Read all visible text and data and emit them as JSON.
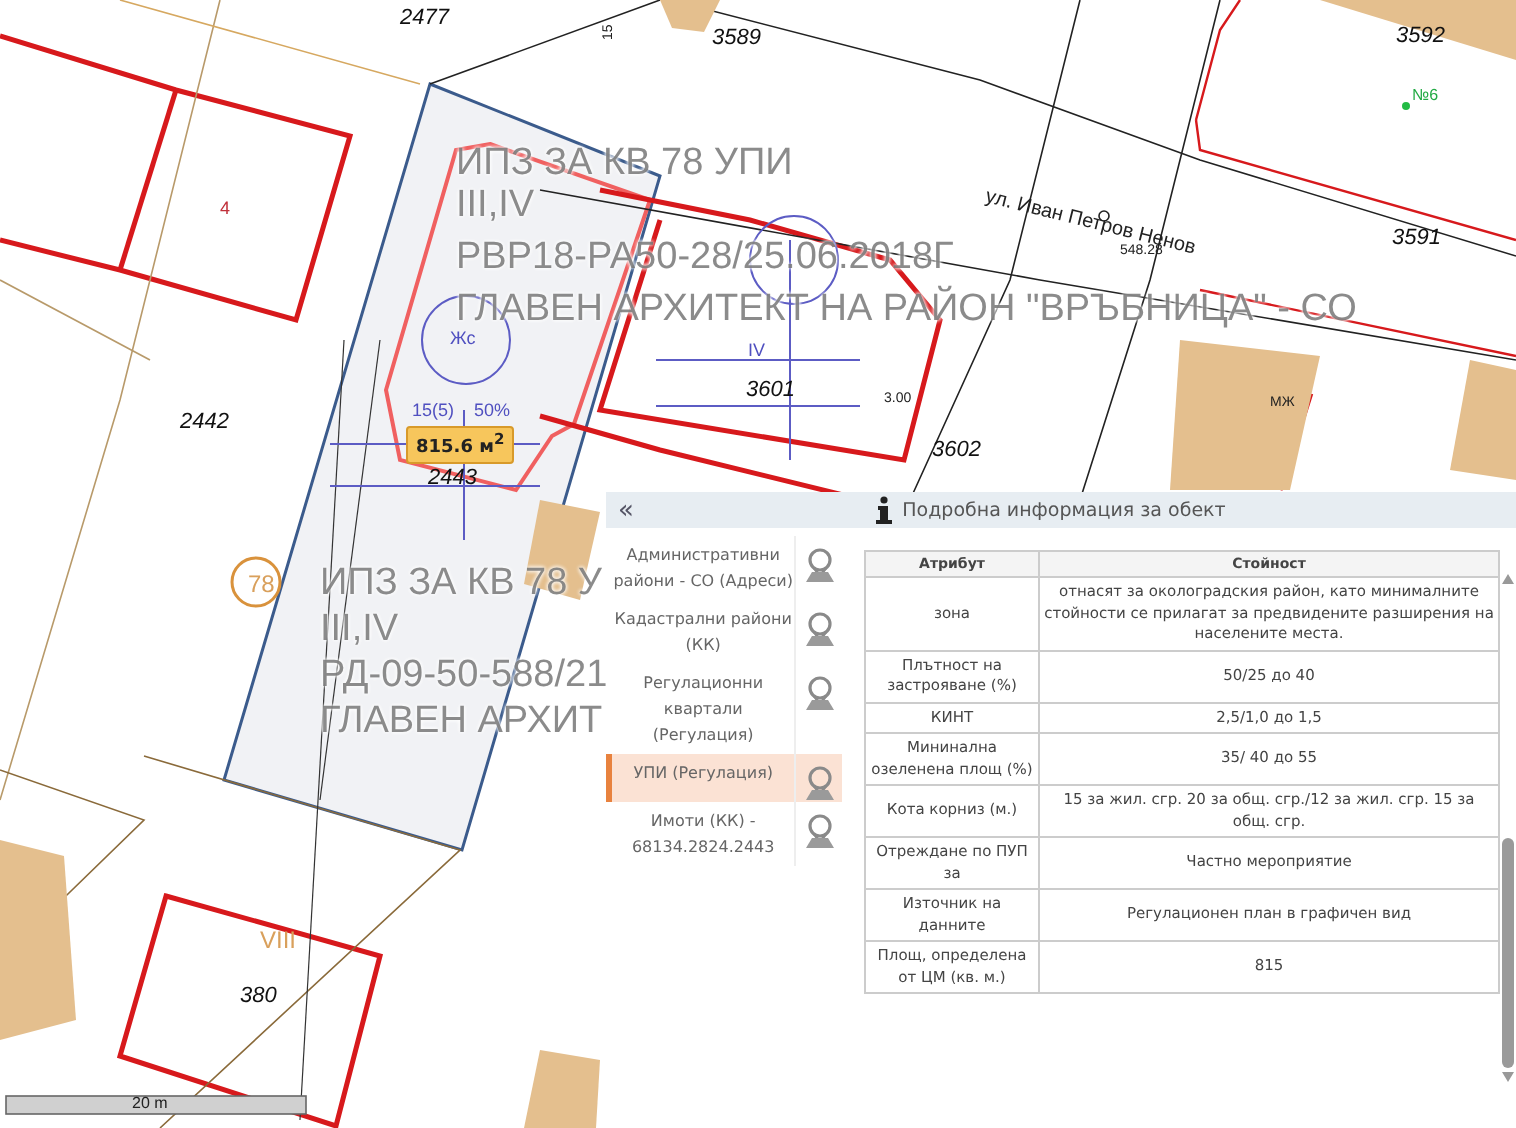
{
  "map": {
    "labels": [
      {
        "text": "2477",
        "kind": "parcel"
      },
      {
        "text": "3589",
        "kind": "parcel"
      },
      {
        "text": "3592",
        "kind": "parcel"
      },
      {
        "text": "№6",
        "kind": "point"
      },
      {
        "text": "ул. Иван Петров Ненов",
        "kind": "street"
      },
      {
        "text": "548.28",
        "kind": "tiny"
      },
      {
        "text": "3591",
        "kind": "parcel"
      },
      {
        "text": "ИПЗ ЗА КВ 78 УПИ",
        "kind": "overlay"
      },
      {
        "text": "III,IV",
        "kind": "overlay"
      },
      {
        "text": "РВР18-РА50-28/25.06.2018Г",
        "kind": "overlay"
      },
      {
        "text": "ГЛАВЕН АРХИТЕКТ НА РАЙОН \"ВРЪБНИЦА\" - СО",
        "kind": "overlay"
      },
      {
        "text": "4",
        "kind": "red"
      },
      {
        "text": "Жс",
        "kind": "plan"
      },
      {
        "text": "15(5)",
        "kind": "plan"
      },
      {
        "text": "50%",
        "kind": "plan"
      },
      {
        "text": "815.6 м$^{2}$",
        "kind": "area"
      },
      {
        "text": "2443",
        "kind": "parcel"
      },
      {
        "text": "2442",
        "kind": "parcel"
      },
      {
        "text": "3601",
        "kind": "parcel"
      },
      {
        "text": "3602",
        "kind": "parcel"
      },
      {
        "text": "3.00",
        "kind": "tiny"
      },
      {
        "text": "IV",
        "kind": "plan"
      },
      {
        "text": "МЖ",
        "kind": "tiny"
      },
      {
        "text": "78",
        "kind": "orange"
      },
      {
        "text": "ИПЗ ЗА КВ 78 У",
        "kind": "overlay"
      },
      {
        "text": "III,IV",
        "kind": "overlay"
      },
      {
        "text": "РД-09-50-588/21",
        "kind": "overlay"
      },
      {
        "text": "ГЛАВЕН АРХИТ",
        "kind": "overlay"
      },
      {
        "text": "VIII",
        "kind": "orange"
      },
      {
        "text": "380",
        "kind": "parcel"
      },
      {
        "text": "15",
        "kind": "tiny"
      }
    ],
    "scale": {
      "text": "20 m"
    }
  },
  "panel": {
    "collapse": "«",
    "title": "Подробна информация за обект",
    "layers": [
      {
        "label": "Административни райони - СО (Адреси)",
        "selected": false
      },
      {
        "label": "Кадастрални райони (КК)",
        "selected": false
      },
      {
        "label": "Регулационни квартали (Регулация)",
        "selected": false
      },
      {
        "label": "УПИ (Регулация)",
        "selected": true
      },
      {
        "label": "Имоти (КК) - 68134.2824.2443",
        "selected": false
      }
    ],
    "table": {
      "columns": [
        "Атрибут",
        "Стойност"
      ],
      "rows": [
        [
          "зона",
          "отнасят за околоградския район, като минималните стойности се прилагат за предвидените разширения на населените места."
        ],
        [
          "Плътност на застрояване (%)",
          "50/25 до 40"
        ],
        [
          "КИНТ",
          "2,5/1,0 до 1,5"
        ],
        [
          "Мининална озеленена площ (%)",
          "35/ 40 до 55"
        ],
        [
          "Кота корниз (м.)",
          "15 за жил. сгр. 20 за общ. сгр./12 за жил. сгр. 15 за общ. сгр."
        ],
        [
          "Отреждане по ПУП за",
          "Частно мероприятие"
        ],
        [
          "Източник на данните",
          "Регулационен план в графичен вид"
        ],
        [
          "Площ, определена от ЦМ (кв. м.)",
          "815"
        ]
      ]
    }
  }
}
